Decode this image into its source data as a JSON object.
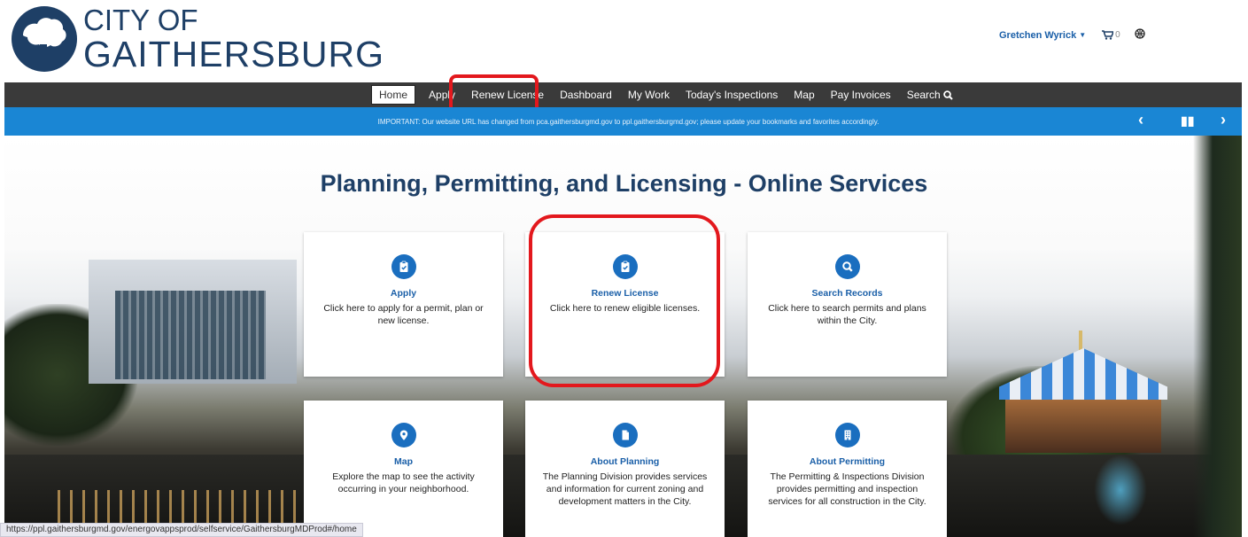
{
  "header": {
    "logo_line1": "CITY OF",
    "logo_line2": "GAITHERSBURG",
    "user_name": "Gretchen Wyrick",
    "cart_count": "0"
  },
  "nav": {
    "items": [
      {
        "label": "Home"
      },
      {
        "label": "Apply"
      },
      {
        "label": "Renew License"
      },
      {
        "label": "Dashboard"
      },
      {
        "label": "My Work"
      },
      {
        "label": "Today's Inspections"
      },
      {
        "label": "Map"
      },
      {
        "label": "Pay Invoices"
      },
      {
        "label": "Search"
      }
    ]
  },
  "banner": {
    "text": "IMPORTANT: Our website URL has changed from pca.gaithersburgmd.gov to ppl.gaithersburgmd.gov; please update your bookmarks and favorites accordingly."
  },
  "hero": {
    "title": "Planning, Permitting, and Licensing - Online Services"
  },
  "cards": [
    {
      "title": "Apply",
      "desc": "Click here to apply for a permit, plan or new license."
    },
    {
      "title": "Renew License",
      "desc": "Click here to renew eligible licenses."
    },
    {
      "title": "Search Records",
      "desc": "Click here to search permits and plans within the City."
    },
    {
      "title": "Map",
      "desc": "Explore the map to see the activity occurring in your neighborhood."
    },
    {
      "title": "About Planning",
      "desc": "The Planning Division provides services and information for current zoning and development matters in the City."
    },
    {
      "title": "About Permitting",
      "desc": "The Permitting & Inspections Division provides permitting and inspection services for all construction in the City."
    }
  ],
  "status_url": "https://ppl.gaithersburgmd.gov/energovappsprod/selfservice/GaithersburgMDProd#/home",
  "colors": {
    "brand": "#1e3f66",
    "accent": "#1a6ebf",
    "banner": "#1a86d4",
    "nav": "#3a3a3a",
    "highlight": "#e3181d"
  }
}
